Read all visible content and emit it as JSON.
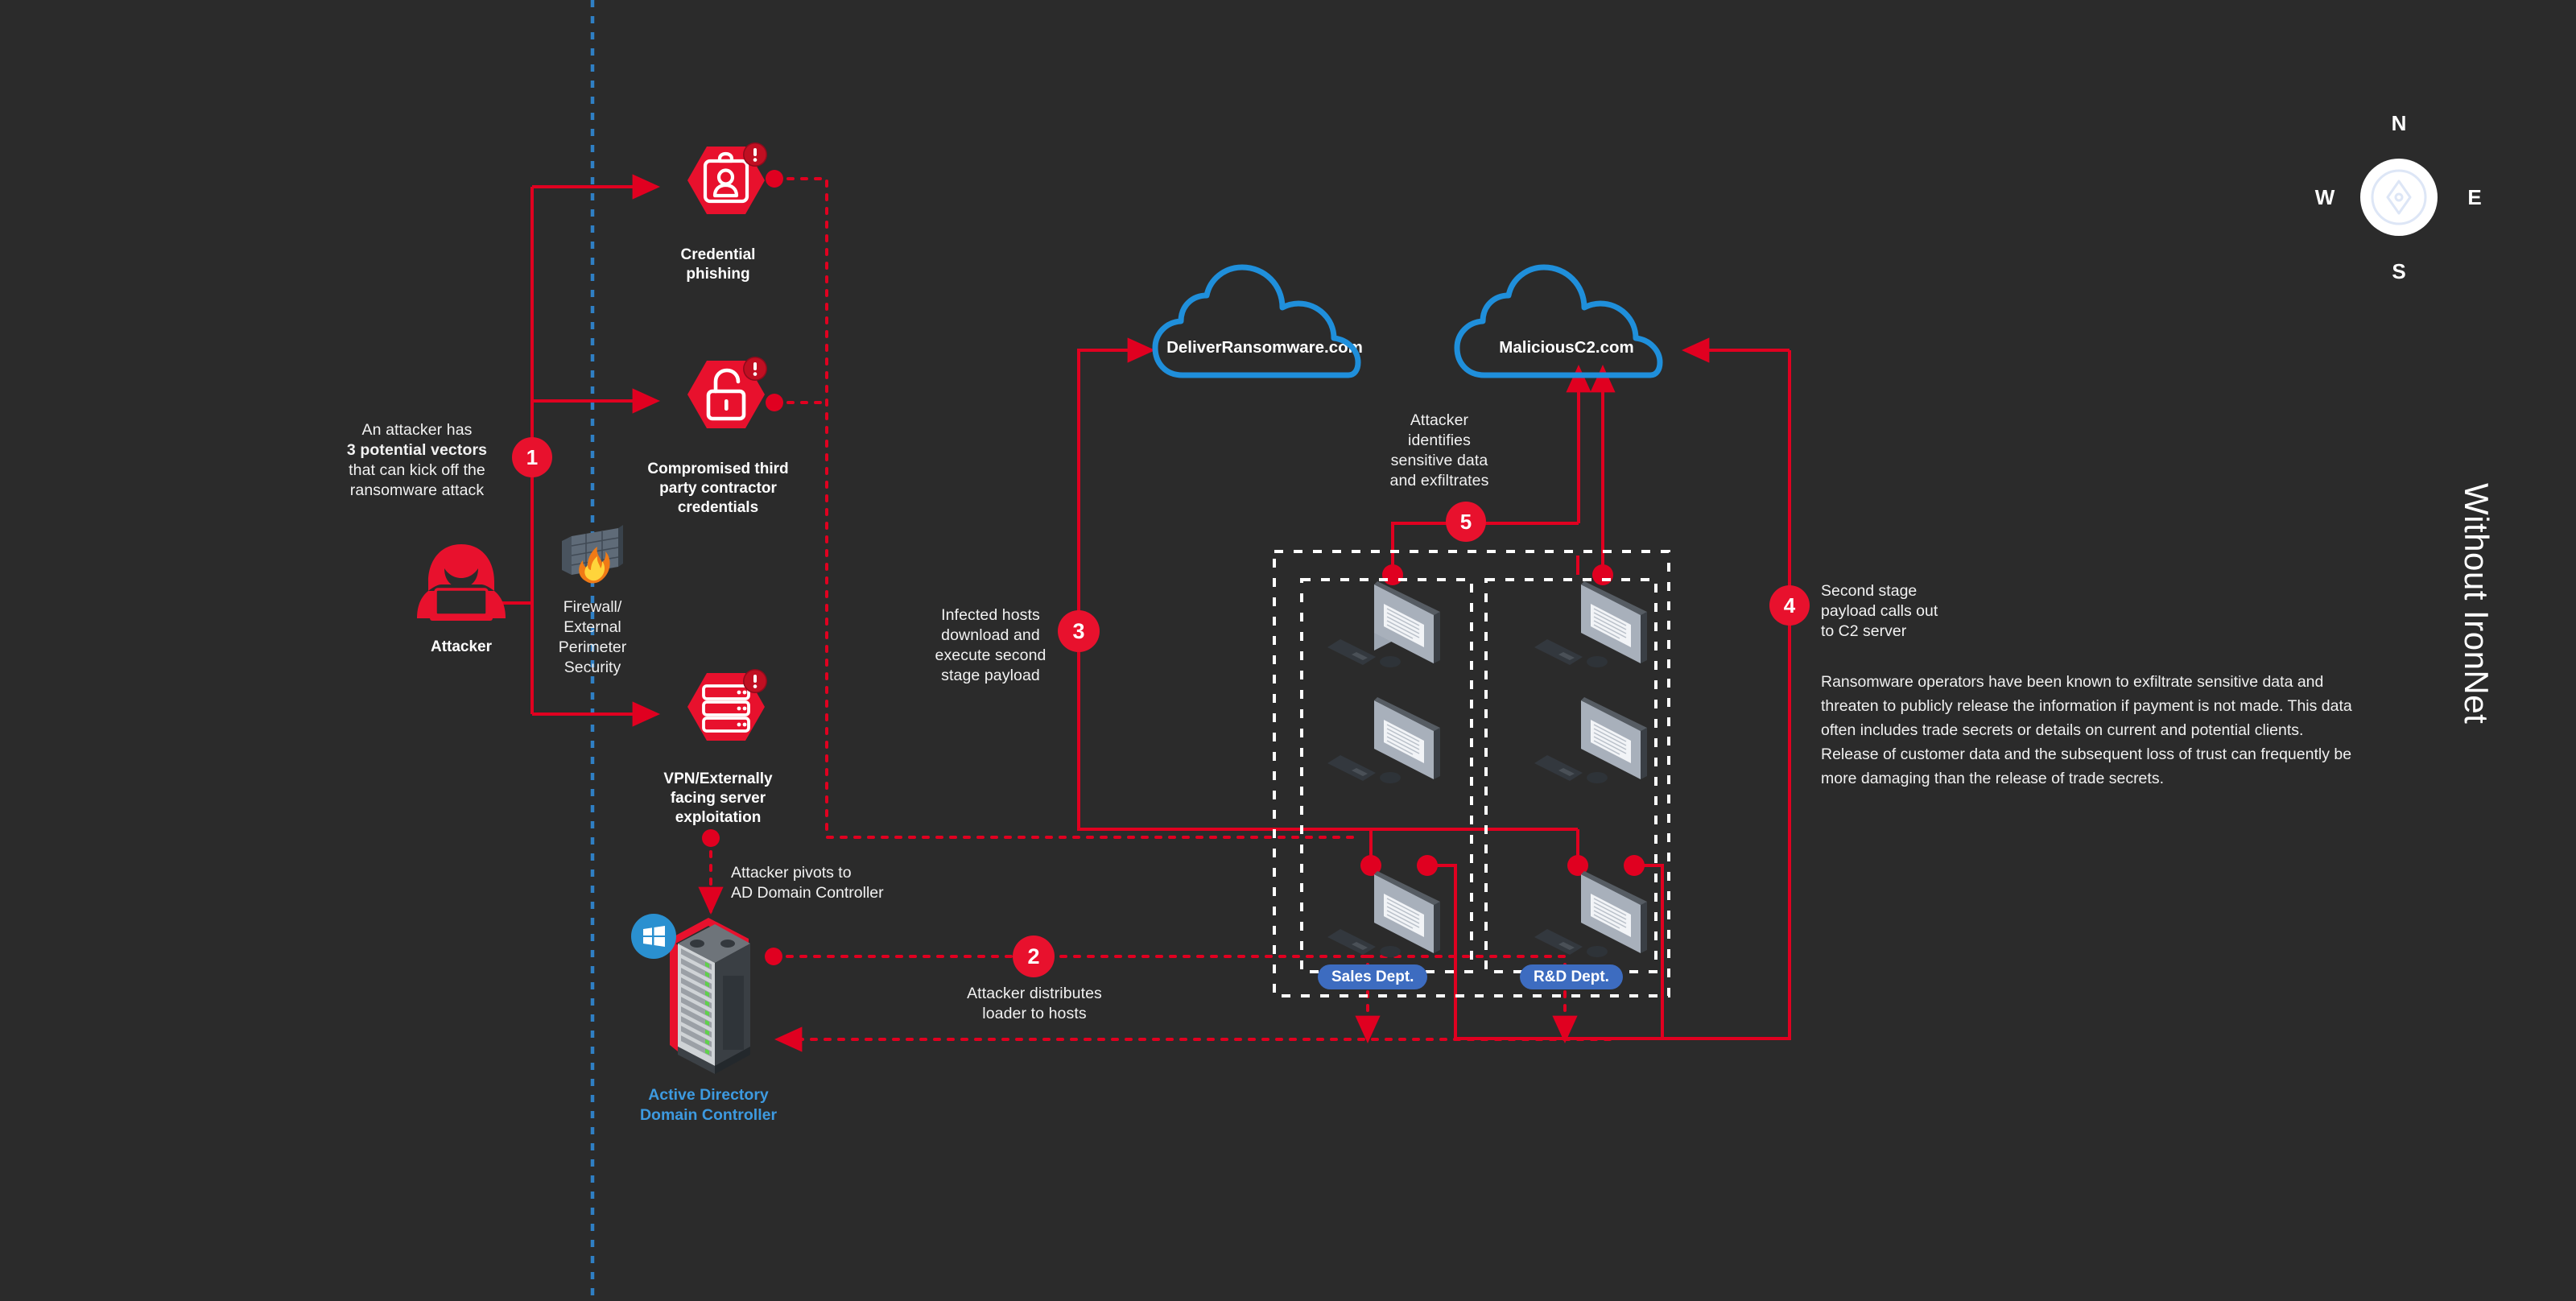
{
  "diagram": {
    "title": "Without IronNet",
    "side_label": "Without IronNet"
  },
  "compass": {
    "north": "N",
    "east": "E",
    "south": "S",
    "west": "W",
    "icon": "compass-icon"
  },
  "colors": {
    "background": "#2b2b2b",
    "accent_red": "#e8112d",
    "line_red": "#e00020",
    "cloud_blue": "#1f8fdb",
    "dept_blue": "#3d6cc0",
    "ad_label_blue": "#3d9ae0",
    "perimeter_blue": "#2f7fc4",
    "enclave_white": "#ffffff"
  },
  "actors": {
    "attacker": {
      "label": "Attacker",
      "icon": "hacker-icon"
    },
    "firewall": {
      "label": "Firewall/\nExternal\nPerimeter\nSecurity",
      "line1": "Firewall/",
      "line2": "External",
      "line3": "Perimeter",
      "line4": "Security",
      "icon": "firewall-brick-flame-icon"
    },
    "active_directory": {
      "label_line1": "Active Directory",
      "label_line2": "Domain Controller",
      "icon": "server-rack-icon",
      "os_badge": "windows-logo-icon"
    }
  },
  "vectors": [
    {
      "id": "credential-phishing",
      "label_line1": "Credential",
      "label_line2": "phishing",
      "icon": "id-badge-icon",
      "alert": "!"
    },
    {
      "id": "third-party-credentials",
      "label_line1": "Compromised third",
      "label_line2": "party contractor",
      "label_line3": "credentials",
      "icon": "open-padlock-icon",
      "alert": "!"
    },
    {
      "id": "vpn-server-exploitation",
      "label_line1": "VPN/Externally",
      "label_line2": "facing server",
      "label_line3": "exploitation",
      "icon": "server-stack-icon",
      "alert": "!"
    }
  ],
  "clouds": [
    {
      "id": "deliver-ransomware",
      "label": "DeliverRansomware.com",
      "icon": "cloud-icon"
    },
    {
      "id": "malicious-c2",
      "label": "MaliciousC2.com",
      "icon": "cloud-icon"
    }
  ],
  "departments": [
    {
      "id": "sales",
      "label": "Sales Dept.",
      "host_count": 3,
      "host_icon": "desktop-computer-icon"
    },
    {
      "id": "rd",
      "label": "R&D Dept.",
      "host_count": 3,
      "host_icon": "desktop-computer-icon"
    }
  ],
  "steps": [
    {
      "number": "1",
      "text_prefix": "An attacker has ",
      "text_bold": "3 potential vectors",
      "text_suffix": " that can kick off the ransomware attack",
      "line1": "An attacker has",
      "line2": "3 potential vectors",
      "line3": "that can kick off the",
      "line4": "ransomware attack"
    },
    {
      "number": "2",
      "line1": "Attacker distributes",
      "line2": "loader to hosts"
    },
    {
      "number": "3",
      "line1": "Infected hosts",
      "line2": "download and",
      "line3": "execute second",
      "line4": "stage payload"
    },
    {
      "number": "4",
      "line1": "Second stage",
      "line2": "payload calls out",
      "line3": "to C2 server"
    },
    {
      "number": "5",
      "line1": "Attacker",
      "line2": "identifies",
      "line3": "sensitive data",
      "line4": "and exfiltrates"
    }
  ],
  "annotations": {
    "pivot_line1": "Attacker pivots to",
    "pivot_line2": "AD Domain Controller"
  },
  "body_paragraph": "Ransomware operators have been known to exfiltrate sensitive data and threaten to publicly release the information if payment is not made. This data often includes trade secrets or details on current and potential clients. Release of customer data and the subsequent loss of trust can frequently be more damaging than the release of trade secrets."
}
